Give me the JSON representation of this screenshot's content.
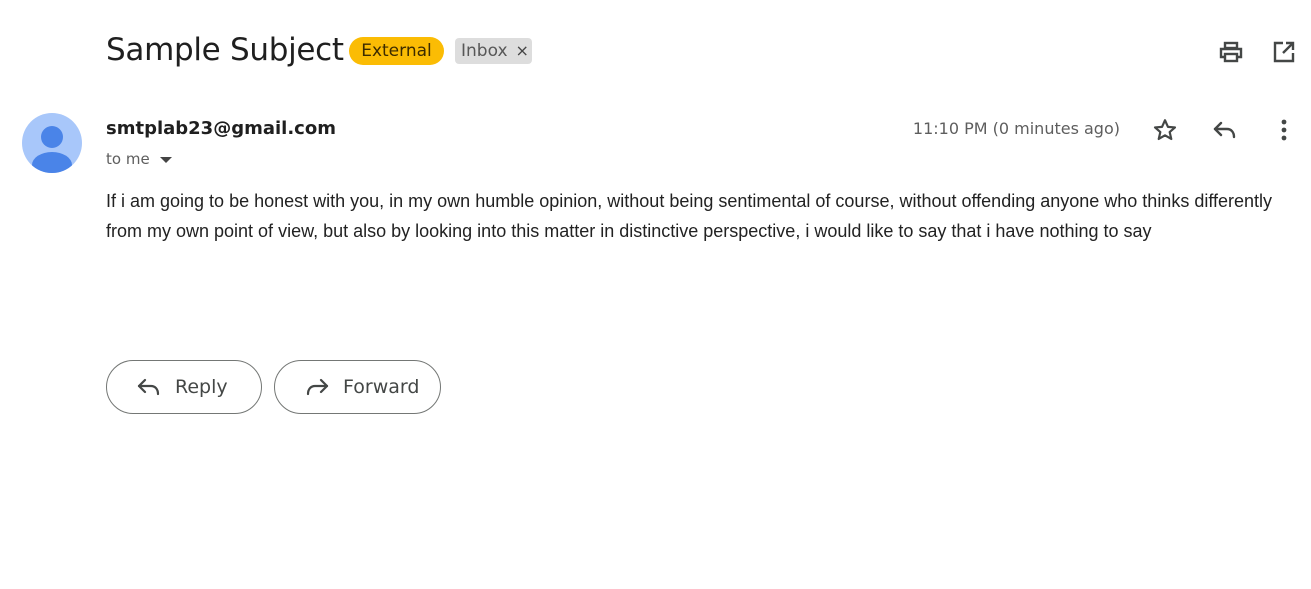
{
  "header": {
    "subject": "Sample Subject",
    "labels": {
      "external": "External",
      "inbox": "Inbox",
      "inbox_remove": "×"
    },
    "icons": [
      "print-icon",
      "open-in-new-window-icon"
    ]
  },
  "message": {
    "sender_email": "smtplab23@gmail.com",
    "recipient_summary": "to me",
    "timestamp": "11:10 PM (0 minutes ago)",
    "body": " If i am going to be honest with you, in my own humble opinion, without being sentimental of course, without offending anyone who thinks differently from my own point of view, but also by looking into this matter in distinctive perspective, i would like to say that i have nothing to say",
    "row_icons": [
      "star-icon",
      "reply-icon",
      "more-vertical-icon"
    ]
  },
  "actions": {
    "reply_label": "Reply",
    "forward_label": "Forward"
  },
  "colors": {
    "external_chip": "#fbbc04",
    "inbox_chip": "#dddddd",
    "avatar_bg": "#a8c7fa",
    "avatar_fg": "#4a84e8"
  }
}
